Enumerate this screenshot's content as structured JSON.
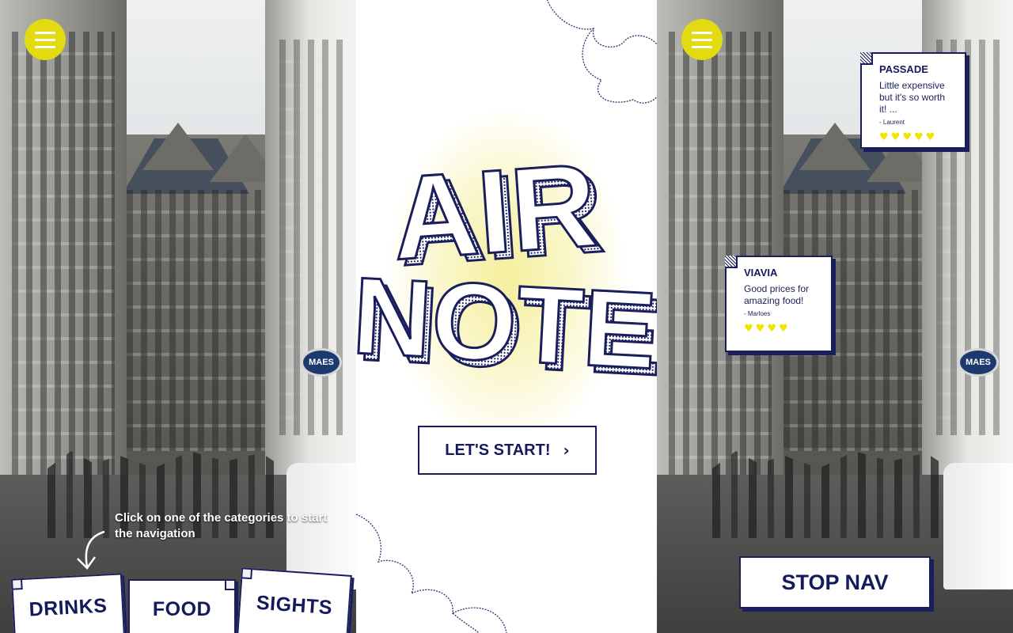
{
  "left_screen": {
    "hint_text": "Click on one of the categories to start the navigation",
    "categories": [
      {
        "label": "DRINKS"
      },
      {
        "label": "FOOD"
      },
      {
        "label": "SIGHTS"
      }
    ],
    "sign_text": "MAES"
  },
  "intro_screen": {
    "logo_line_1": "AIR",
    "logo_line_2": "NOTE",
    "start_label": "LET'S START!",
    "start_icon": "chevron-right-icon"
  },
  "nav_screen": {
    "notes": [
      {
        "title": "PASSADE",
        "text": "Little expensive but it's so worth it! ...",
        "author": "- Laurent",
        "rating": 5
      },
      {
        "title": "VIAVIA",
        "text": "Good prices for amazing food!",
        "author": "- Marloes",
        "rating": 4
      }
    ],
    "stop_label": "STOP NAV",
    "sign_text": "MAES"
  },
  "colors": {
    "accent": "#e2db12",
    "ink": "#141a5c",
    "heart": "#f2e400"
  },
  "icons": {
    "menu": "hamburger-menu-icon",
    "hint_arrow": "curved-arrow-down-icon",
    "rating": "heart-icon"
  }
}
